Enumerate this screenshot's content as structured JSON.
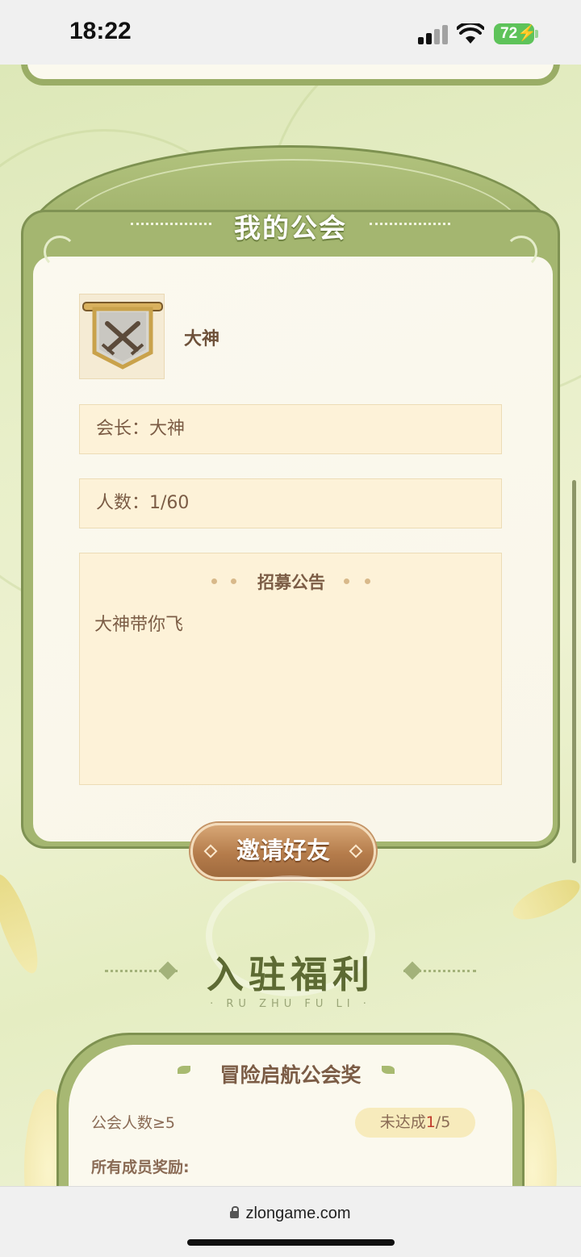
{
  "status_bar": {
    "time": "18:22",
    "battery": "72"
  },
  "guild_card": {
    "title": "我的公会",
    "guild_name": "大神",
    "leader_label": "会长：大神",
    "members_label": "人数：1/60",
    "notice_title": "招募公告",
    "notice_text": "大神带你飞",
    "invite_button": "邀请好友",
    "emblem_icon": "crossed-swords-banner-icon"
  },
  "benefits_section": {
    "title": "入驻福利",
    "subtitle": "· RU ZHU FU LI ·"
  },
  "reward_card": {
    "title": "冒险启航公会奖",
    "condition": "公会人数≥5",
    "progress_prefix": "未达成",
    "progress_current": "1",
    "progress_total": "/5",
    "reward_label": "所有成员奖励:"
  },
  "browser": {
    "url": "zlongame.com"
  },
  "colors": {
    "frame_green": "#a4b670",
    "text_brown": "#7b5c45",
    "button_brown": "#b57c4b",
    "progress_red": "#c0392b"
  }
}
